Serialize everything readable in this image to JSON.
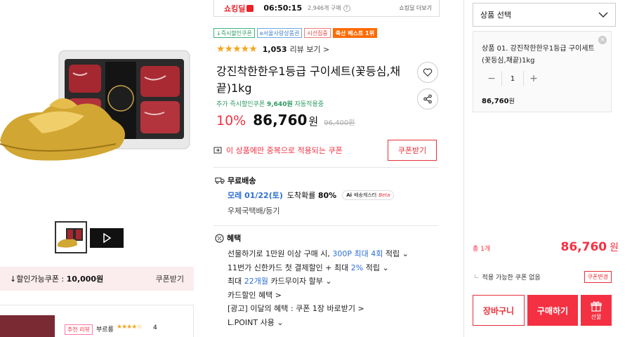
{
  "topbar": {
    "logo": "쇼킹딜",
    "timer": "06:50:15",
    "purchase_count": "2,946개 구매",
    "help": "?",
    "more": "쇼킹딜 더보기"
  },
  "badges": [
    "↓즉시할인쿠폰",
    "e서울사랑상품권",
    "시선집중",
    "축산 베스트 1위"
  ],
  "rating": {
    "stars": "★★★★★",
    "review_count": "1,053",
    "review_link": "리뷰 보기 >"
  },
  "product": {
    "title": "강진착한한우1등급 구이세트(꽃등심,채끝)1kg",
    "extra_coupon_prefix": "추가 즉시할인쿠폰",
    "extra_coupon_amount": "9,640원",
    "extra_coupon_suffix": "자동적용중",
    "discount_pct": "10%",
    "price": "86,760",
    "price_unit": "원",
    "original_price": "96,400원"
  },
  "dup_coupon": {
    "text": "이 상품에만 중복으로 적용되는 쿠폰",
    "button": "쿠폰받기"
  },
  "shipping": {
    "title": "무료배송",
    "date": "모레 01/22(토)",
    "prob_label": "도착확률",
    "prob_value": "80%",
    "ai_label": "Ai",
    "ai_text": "배송캐스터",
    "ai_beta": "Beta",
    "method": "우체국택배/등기"
  },
  "benefits": {
    "title": "혜택",
    "line1_a": "선물하기로 1만원 이상 구매 시,",
    "line1_b": "300P 최대 4회",
    "line1_c": "적립 ⌄",
    "line2_a": "11번가 신한카드 첫 결제할인 + 최대",
    "line2_b": "2%",
    "line2_c": "적립 ⌄",
    "line3_a": "최대",
    "line3_b": "22개월",
    "line3_c": "카드무이자 할부 ⌄",
    "line4": "카드할인 혜택  >",
    "line5": "[광고] 이달의 혜택 : 쿠폰 1장 바로받기 >",
    "line6": "L.POINT 사용 ⌄"
  },
  "left": {
    "coupon_label": "↓할인가능쿠폰 :",
    "coupon_amount": "10,000원",
    "coupon_button": "쿠폰받기",
    "review_tag": "추천 리뷰",
    "review_name": "부르릉",
    "review_stars": "★★★★☆",
    "review_score": "4"
  },
  "panel": {
    "select_label": "상품 선택",
    "option_name": "상품 01. 강진착한한우1등급 구이세트(꽃등심,채끝)1kg",
    "qty": "1",
    "option_price": "86,760",
    "option_price_unit": "원",
    "total_count": "총 1개",
    "total_price": "86,760",
    "total_unit": "원",
    "no_coupon": "적용 가능한 쿠폰 없음",
    "coupon_change": "쿠폰변경",
    "cart": "장바구니",
    "buy": "구매하기",
    "gift": "선물"
  },
  "colors": {
    "accent": "#f43142",
    "green": "#2b9a61",
    "blue": "#2d6fd6",
    "star": "#f5a623"
  }
}
